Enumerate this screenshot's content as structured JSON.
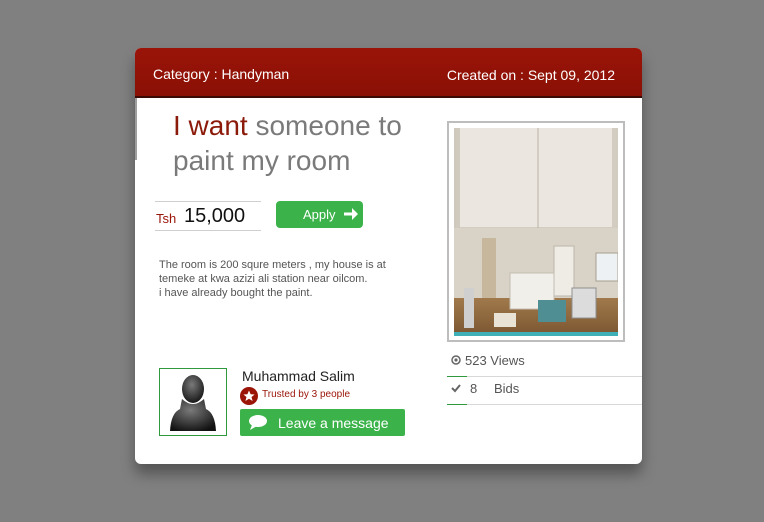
{
  "header": {
    "category": "Category : Handyman",
    "created_on": "Created on : Sept 09, 2012"
  },
  "listing": {
    "title_highlight": "I want",
    "title_rest": " someone to paint my room",
    "currency": "Tsh",
    "price": "15,000",
    "apply_label": "Apply",
    "description_lines": [
      "The room is 200 squre meters , my house is at",
      "temeke at kwa azizi ali station near oilcom.",
      "i have already bought the paint."
    ]
  },
  "stats": {
    "views": "523 Views",
    "bids_count": "8",
    "bids_label": "Bids"
  },
  "user": {
    "name": "Muhammad Salim",
    "trusted": "Trusted by 3 people",
    "message_button": "Leave a message"
  },
  "icons": {
    "apply": "arrow-right-icon",
    "views": "eye-icon",
    "bids": "check-icon",
    "trusted": "star-icon",
    "message": "speech-bubble-icon"
  },
  "colors": {
    "header": "#8a1006",
    "accent_red": "#9a1408",
    "button_green": "#3bb34a",
    "background": "#808080"
  }
}
